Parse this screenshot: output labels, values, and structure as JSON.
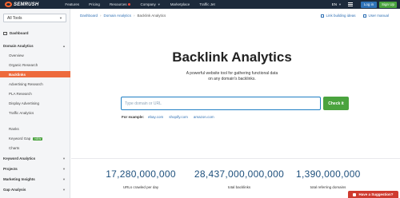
{
  "header": {
    "logo_text": "SEMRUSH",
    "nav": [
      {
        "label": "Features",
        "dot": false,
        "caret": false
      },
      {
        "label": "Pricing",
        "dot": false,
        "caret": false
      },
      {
        "label": "Resources",
        "dot": true,
        "caret": false
      },
      {
        "label": "Company",
        "dot": false,
        "caret": true
      },
      {
        "label": "Marketplace",
        "dot": false,
        "caret": false
      },
      {
        "label": "Traffic Jet",
        "dot": false,
        "caret": false
      }
    ],
    "lang": "EN",
    "login_label": "Log in",
    "signup_label": "Sign Up"
  },
  "sidebar": {
    "tools_select": "All Tools",
    "dashboard": "Dashboard",
    "domain_analytics": "Domain Analytics",
    "domain_items": [
      "Overview",
      "Organic Research",
      "Backlinks",
      "Advertising Research",
      "PLA Research",
      "Display Advertising",
      "Traffic Analytics"
    ],
    "active_item": "Backlinks",
    "other_items": [
      "Ranks",
      "Keyword Gap",
      "Charts"
    ],
    "new_badge": "NEW",
    "sections": [
      "Keyword Analytics",
      "Projects",
      "Marketing Insights",
      "Gap Analysis"
    ]
  },
  "breadcrumb": [
    "Dashboard",
    "Domain Analytics",
    "Backlink Analytics"
  ],
  "top_links": {
    "ideas": "Link building ideas",
    "manual": "User manual"
  },
  "main": {
    "title": "Backlink Analytics",
    "subtitle_line1": "A powerful website tool for gathering functional data",
    "subtitle_line2": "on any domain's backlinks.",
    "search_placeholder": "Type domain or URL",
    "check_label": "Check it",
    "example_label": "For example:",
    "examples": [
      "ebay.com",
      "shopify.com",
      "amazon.com"
    ]
  },
  "stats": [
    {
      "value": "17,280,000,000",
      "label": "URLs crawled per day"
    },
    {
      "value": "28,437,000,000,000",
      "label": "total backlinks"
    },
    {
      "value": "1,390,000,000",
      "label": "total referring domains"
    }
  ],
  "suggestion": "Have a Suggestion?",
  "colors": {
    "topbar": "#1c2a3b",
    "accent_orange": "#ed6a3c",
    "green": "#4aa33e",
    "link_blue": "#2e6fb3",
    "stat_blue": "#1d4f7c",
    "suggest_red": "#cf3a2f"
  }
}
